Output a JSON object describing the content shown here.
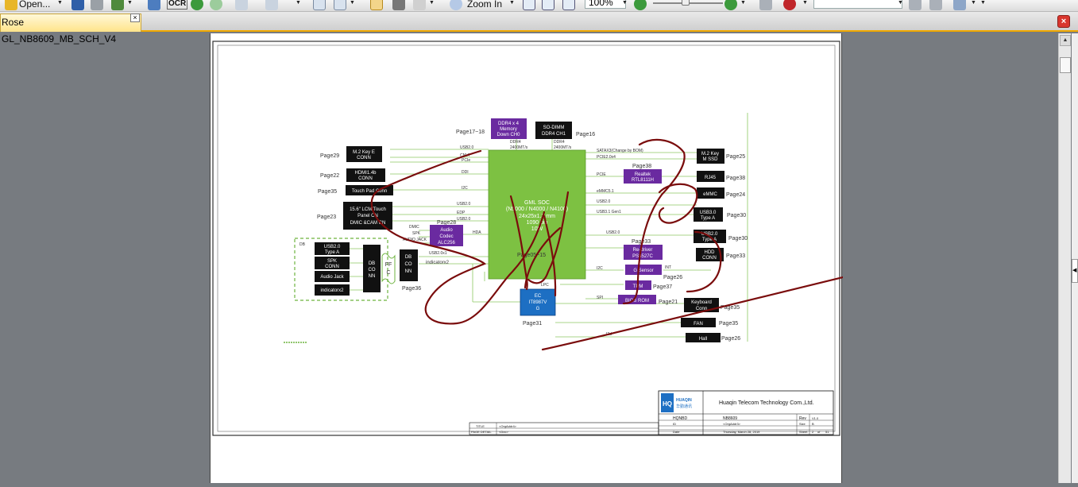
{
  "toolbar": {
    "open_label": "Open...",
    "ocr_label": "OCR",
    "zoom_in_label": "Zoom In",
    "zoom_value": "100%",
    "search_placeholder": ""
  },
  "tab": {
    "title": "Rose GL_NB8609_MB_SCH_V4",
    "close": "×"
  },
  "window_close": "×",
  "schematic": {
    "page17_18": "Page17~18",
    "page16": "Page16",
    "ddr4_mem": [
      "DDR4 x 4",
      "Memory",
      "Down CH0"
    ],
    "sodimm": [
      "SO-DIMM",
      "DDR4 CH1"
    ],
    "ddr4_l": "DDR4",
    "ddr4_r": "DDR4",
    "speed_l": "2400MT/s",
    "speed_r": "2400MT/s",
    "left_blocks": [
      {
        "page": "Page29",
        "lines": [
          "M.2 Key E",
          "CONN"
        ]
      },
      {
        "page": "Page22",
        "lines": [
          "HDMI1.4b",
          "CONN"
        ]
      },
      {
        "page": "Page35",
        "lines": [
          "Touch Pad Conn"
        ]
      },
      {
        "page": "Page23",
        "lines": [
          "15.6\" LCM/Touch",
          "Panel CN",
          "DMIC  &CAM CN"
        ]
      }
    ],
    "left_signals": [
      "USB2.0",
      "CNVI",
      "PCIe",
      "DDI",
      "I2C",
      "USB2.0",
      "EDP",
      "USB2.0",
      "DMIC",
      "SPK",
      "AUDIO JACK",
      "HDA",
      "USB2.0x1",
      "indicatorx2"
    ],
    "soc": [
      "GML SOC",
      "(N5000 / N4000 / N4100)",
      "24x25x1.3 mm",
      "1090 pin",
      "10W"
    ],
    "soc_page": "Page05~15",
    "audio_page": "Page28",
    "audio": [
      "Audio",
      "Codec",
      "ALC256"
    ],
    "db_label": "DB",
    "db_blocks": [
      [
        "USB2.0",
        "Type A"
      ],
      [
        "SPK",
        "CONN"
      ],
      [
        "Audio Jack"
      ],
      [
        "indicatorx2"
      ]
    ],
    "dbconn_a": [
      "DB",
      "CO",
      "NN"
    ],
    "ffc": [
      "FF",
      "C"
    ],
    "dbconn_b": [
      "DB",
      "CO",
      "NN"
    ],
    "page36": "Page36",
    "ec": [
      "EC",
      "IT8987V",
      "G"
    ],
    "page31": "Page31",
    "right_signals": [
      "SATAX3(Change by BOM)",
      "PCIE2.0x4",
      "PCIE",
      "eMMC5.1",
      "USB2.0",
      "USB3.1 Gen1",
      "USB2.0",
      "I2C",
      "INT",
      "LPC",
      "SPI",
      "I2d"
    ],
    "realtek_page": "Page38",
    "realtek": [
      "Realtek",
      "RTL8111H"
    ],
    "redriver_page": "Page33",
    "redriver": [
      "Re-driver",
      "PS8527C"
    ],
    "gsensor": "G Sensor",
    "gsensor_page": "Page26",
    "tpm": "TPM",
    "tpm_page": "Page37",
    "biosrom": "BIOS ROM",
    "biosrom_page": "Page21",
    "right_blocks": [
      {
        "page": "Page25",
        "lines": [
          "M.2 Key",
          "M SSD"
        ]
      },
      {
        "page": "Page38",
        "lines": [
          "RJ45"
        ]
      },
      {
        "page": "Page24",
        "lines": [
          "eMMC"
        ]
      },
      {
        "page": "Page30",
        "lines": [
          "USB3.0",
          "Type A"
        ]
      },
      {
        "page": "Page30",
        "lines": [
          "USB2.0",
          "Type A"
        ]
      },
      {
        "page": "Page33",
        "lines": [
          "HDD",
          "CONN"
        ]
      },
      {
        "page": "Page35",
        "lines": [
          "Keyboard",
          "Conn"
        ]
      },
      {
        "page": "Page35",
        "lines": [
          "FAN"
        ]
      },
      {
        "page": "Page26",
        "lines": [
          "Hall"
        ]
      }
    ],
    "title_block": {
      "company": "Huaqin Telecom Technology Com.,Ltd.",
      "logo_en": "HUAQIN",
      "logo_cn": "华勤通讯",
      "hq_code": "HQNBD",
      "project": "NB8609",
      "rev_label": "Rev",
      "rev": "V1.0",
      "title_label": "TITLE",
      "title_val": "<OrgAddr4>",
      "detail_label": "PAGE DETAIL",
      "detail_val": "<Doc>",
      "id_label": "ID",
      "id_val": "<OrgAddr3>",
      "size_label": "Size",
      "size": "B",
      "date_label": "Date",
      "date": "Thursday, March 28, 2019",
      "sheet_label": "Sheet",
      "sheet": "2",
      "of": "of",
      "total": "51"
    }
  },
  "colors": {
    "soc": "#7dc142",
    "purple": "#6a2aa0",
    "ec_blue": "#1d6fc3",
    "ink": "#7a0c0c",
    "tab_accent": "#f0a800"
  }
}
